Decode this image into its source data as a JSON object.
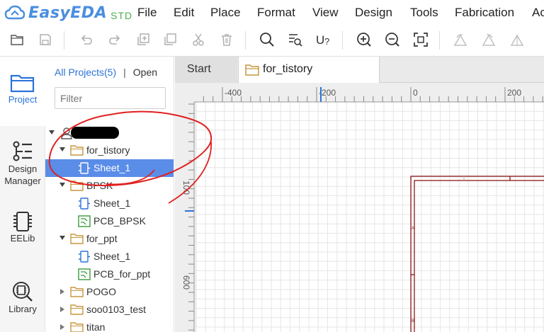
{
  "app": {
    "logo_text": "EasyEDA",
    "logo_edition": "STD",
    "brand_color": "#4a8ee0",
    "edition_color": "#4caf50"
  },
  "menu": {
    "items": [
      "File",
      "Edit",
      "Place",
      "Format",
      "View",
      "Design",
      "Tools",
      "Fabrication",
      "Ac"
    ]
  },
  "toolbar": {
    "icons": [
      "folder-open-icon",
      "save-icon",
      "undo-icon",
      "redo-icon",
      "duplicate-icon",
      "copy-icon",
      "cut-icon",
      "delete-icon",
      "search-icon",
      "find-list-icon",
      "annotate-icon",
      "zoom-in-icon",
      "zoom-out-icon",
      "fit-view-icon",
      "rotate-left-icon",
      "rotate-right-icon",
      "flip-icon"
    ]
  },
  "rail": {
    "project": "Project",
    "design_manager_line1": "Design",
    "design_manager_line2": "Manager",
    "eelib": "EELib",
    "library": "Library",
    "accent": "#2b73d8"
  },
  "panel": {
    "tab_all": "All Projects(5)",
    "tab_sep": "|",
    "tab_open": "Open",
    "filter_placeholder": "Filter",
    "tree": [
      {
        "label": "for_tistory",
        "type": "project"
      },
      {
        "label": "Sheet_1",
        "type": "schematic",
        "selected": true
      },
      {
        "label": "BPSK",
        "type": "project"
      },
      {
        "label": "Sheet_1",
        "type": "schematic"
      },
      {
        "label": "PCB_BPSK",
        "type": "pcb"
      },
      {
        "label": "for_ppt",
        "type": "project"
      },
      {
        "label": "Sheet_1",
        "type": "schematic"
      },
      {
        "label": "PCB_for_ppt",
        "type": "pcb"
      },
      {
        "label": "POGO",
        "type": "project"
      },
      {
        "label": "soo0103_test",
        "type": "project"
      },
      {
        "label": "titan",
        "type": "project"
      }
    ],
    "selection_color": "#5a8de8"
  },
  "editor": {
    "tab_start": "Start",
    "tab_active": "for_tistory",
    "ruler_h": [
      "-400",
      "-200",
      "0",
      "200"
    ],
    "ruler_v": [
      "100",
      "600"
    ],
    "sheet_labels": [
      "A",
      "B"
    ],
    "frame_color": "#8b1a1a",
    "annotation_color": "#e02020"
  }
}
